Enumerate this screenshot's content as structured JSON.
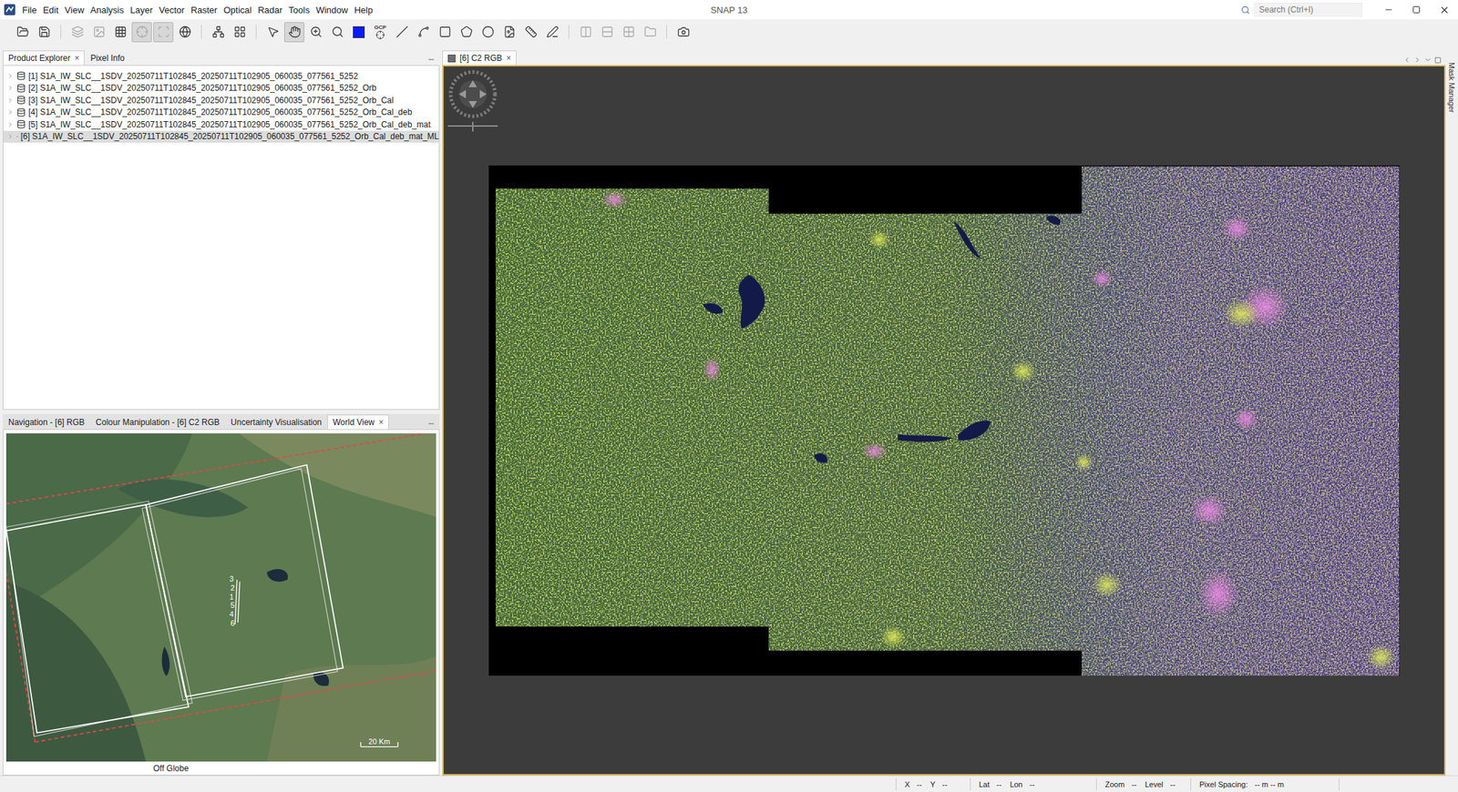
{
  "window": {
    "title": "SNAP 13"
  },
  "menu": [
    "File",
    "Edit",
    "View",
    "Analysis",
    "Layer",
    "Vector",
    "Raster",
    "Optical",
    "Radar",
    "Tools",
    "Window",
    "Help"
  ],
  "search": {
    "placeholder": "Search (Ctrl+I)"
  },
  "toolbar": [
    [
      {
        "kind": "icon",
        "selected": false,
        "disabled": false
      },
      {
        "kind": "icon",
        "selected": false,
        "disabled": false
      }
    ],
    [
      {
        "kind": "icon",
        "selected": false,
        "disabled": true
      },
      {
        "kind": "icon",
        "selected": false,
        "disabled": true
      },
      {
        "kind": "icon",
        "selected": false,
        "disabled": false
      },
      {
        "kind": "icon",
        "selected": true,
        "disabled": true
      },
      {
        "kind": "icon",
        "selected": true,
        "disabled": true
      },
      {
        "kind": "icon",
        "selected": false,
        "disabled": false
      }
    ],
    [
      {
        "kind": "icon",
        "selected": false,
        "disabled": false
      },
      {
        "kind": "icon",
        "selected": false,
        "disabled": false
      }
    ],
    [
      {
        "kind": "icon",
        "selected": false,
        "disabled": false
      },
      {
        "kind": "icon",
        "selected": true,
        "disabled": false
      },
      {
        "kind": "icon",
        "selected": false,
        "disabled": false
      },
      {
        "kind": "icon",
        "selected": false,
        "disabled": false
      },
      {
        "kind": "swatch",
        "selected": false,
        "disabled": false,
        "color": "#0a1cf0"
      },
      {
        "kind": "icon",
        "selected": false,
        "disabled": false,
        "label": "GCP"
      },
      {
        "kind": "icon",
        "selected": false,
        "disabled": false
      },
      {
        "kind": "icon",
        "selected": false,
        "disabled": false
      },
      {
        "kind": "icon",
        "selected": false,
        "disabled": false
      },
      {
        "kind": "icon",
        "selected": false,
        "disabled": false
      },
      {
        "kind": "icon",
        "selected": false,
        "disabled": false
      },
      {
        "kind": "icon",
        "selected": false,
        "disabled": false
      },
      {
        "kind": "icon",
        "selected": false,
        "disabled": false
      },
      {
        "kind": "icon",
        "selected": false,
        "disabled": false
      }
    ],
    [
      {
        "kind": "icon",
        "selected": false,
        "disabled": true
      },
      {
        "kind": "icon",
        "selected": false,
        "disabled": true
      },
      {
        "kind": "icon",
        "selected": false,
        "disabled": true
      },
      {
        "kind": "icon",
        "selected": false,
        "disabled": true
      }
    ],
    [
      {
        "kind": "icon",
        "selected": false,
        "disabled": false
      }
    ]
  ],
  "explorer": {
    "tabs": [
      {
        "label": "Product Explorer",
        "selected": true,
        "close": "×"
      },
      {
        "label": "Pixel Info",
        "selected": false
      }
    ],
    "products": [
      {
        "label": "[1] S1A_IW_SLC__1SDV_20250711T102845_20250711T102905_060035_077561_5252",
        "selected": false,
        "expanded": false
      },
      {
        "label": "[2] S1A_IW_SLC__1SDV_20250711T102845_20250711T102905_060035_077561_5252_Orb",
        "selected": false,
        "expanded": false
      },
      {
        "label": "[3] S1A_IW_SLC__1SDV_20250711T102845_20250711T102905_060035_077561_5252_Orb_Cal",
        "selected": false,
        "expanded": false
      },
      {
        "label": "[4] S1A_IW_SLC__1SDV_20250711T102845_20250711T102905_060035_077561_5252_Orb_Cal_deb",
        "selected": false,
        "expanded": false
      },
      {
        "label": "[5] S1A_IW_SLC__1SDV_20250711T102845_20250711T102905_060035_077561_5252_Orb_Cal_deb_mat",
        "selected": false,
        "expanded": false
      },
      {
        "label": "[6] S1A_IW_SLC__1SDV_20250711T102845_20250711T102905_060035_077561_5252_Orb_Cal_deb_mat_ML",
        "selected": true,
        "expanded": false
      }
    ]
  },
  "tool_tabs": [
    {
      "label": "Navigation - [6] RGB",
      "selected": false
    },
    {
      "label": "Colour Manipulation - [6] C2 RGB",
      "selected": false
    },
    {
      "label": "Uncertainty Visualisation",
      "selected": false
    },
    {
      "label": "World View",
      "selected": true,
      "close": "×"
    }
  ],
  "world_view": {
    "labels": [
      "3",
      "2",
      "1",
      "5",
      "4",
      "6"
    ],
    "scale": "20 Km",
    "status": "Off Globe"
  },
  "editor": {
    "tabs": [
      {
        "label": "[6] C2 RGB",
        "selected": true,
        "close": "×"
      }
    ]
  },
  "side_strip": {
    "label": "Mask Manager"
  },
  "status_bar": [
    {
      "items": [
        {
          "label": "X",
          "value": "--"
        },
        {
          "label": "Y",
          "value": "--"
        }
      ]
    },
    {
      "items": [
        {
          "label": "Lat",
          "value": "--"
        },
        {
          "label": "Lon",
          "value": "--"
        }
      ]
    },
    {
      "items": [
        {
          "label": "Zoom",
          "value": "--"
        },
        {
          "label": "Level",
          "value": "--"
        }
      ]
    },
    {
      "items": [
        {
          "label": "Pixel Spacing:",
          "value": "-- m -- m"
        }
      ]
    }
  ]
}
